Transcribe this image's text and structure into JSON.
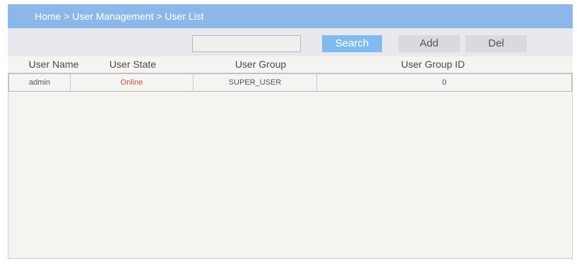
{
  "breadcrumb": {
    "text": "Home > User Management > User List"
  },
  "toolbar": {
    "search_value": "",
    "search_label": "Search",
    "add_label": "Add",
    "del_label": "Del"
  },
  "table": {
    "columns": [
      "User Name",
      "User State",
      "User Group",
      "User Group ID"
    ],
    "rows": [
      {
        "user_name": "admin",
        "user_state": "Online",
        "user_group": "SUPER_USER",
        "user_group_id": "0"
      }
    ]
  },
  "colors": {
    "breadcrumb_bg": "#8bb8e8",
    "search_button_bg": "#7fbbef",
    "secondary_button_bg": "#d9dadc",
    "online_status": "#cc4b3e",
    "panel_bg": "#f6f4f1"
  }
}
